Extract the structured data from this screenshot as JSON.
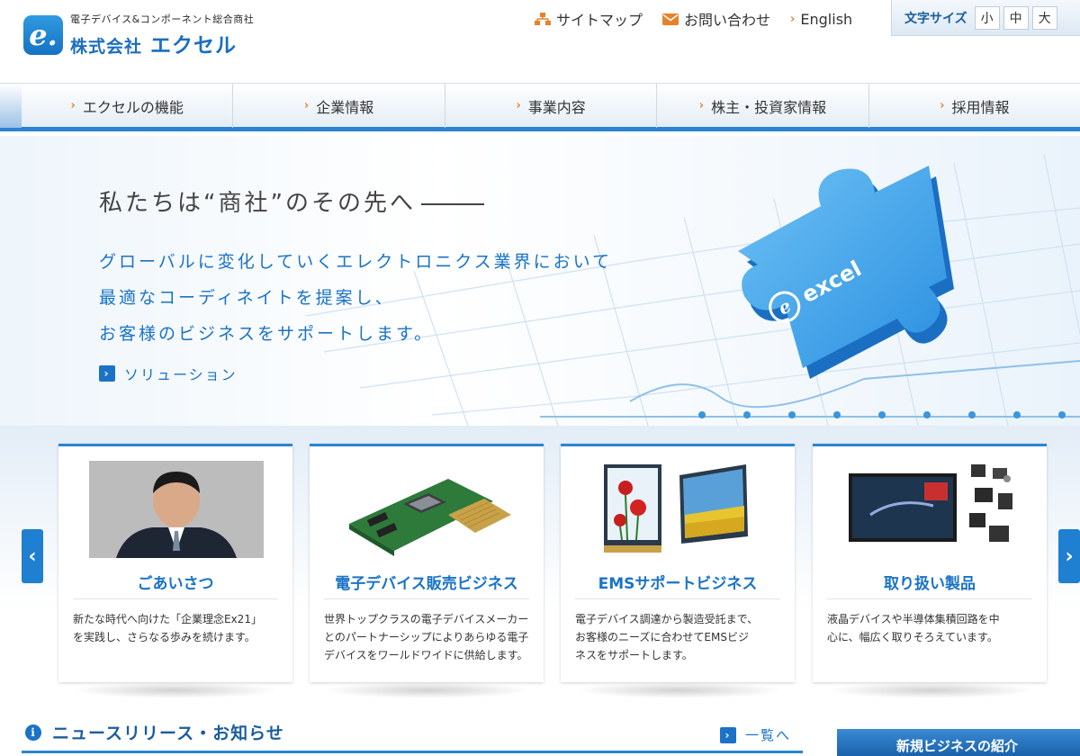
{
  "header": {
    "logo_sub": "電子デバイス&コンポーネント総合商社",
    "logo_kk": "株式会社",
    "logo_name": "エクセル",
    "logo_mark": "e.",
    "links": {
      "sitemap": "サイトマップ",
      "contact": "お問い合わせ",
      "english": "English"
    },
    "font_size": {
      "label": "文字サイズ",
      "small": "小",
      "medium": "中",
      "large": "大"
    }
  },
  "nav": {
    "items": [
      {
        "label": "エクセルの機能"
      },
      {
        "label": "企業情報"
      },
      {
        "label": "事業内容"
      },
      {
        "label": "株主・投資家情報"
      },
      {
        "label": "採用情報"
      }
    ]
  },
  "hero": {
    "title": "私たちは“商社”のその先へ",
    "body_line1": "グローバルに変化していくエレクトロニクス業界において",
    "body_line2": "最適なコーディネイトを提案し、",
    "body_line3": "お客様のビジネスをサポートします。",
    "link": "ソリューション",
    "puzzle_text": "excel"
  },
  "cards": [
    {
      "title": "ごあいさつ",
      "desc_line1": "新たな時代へ向けた「企業理念Ex21」",
      "desc_line2": "を実践し、さらなる歩みを続けます。",
      "desc_line3": ""
    },
    {
      "title": "電子デバイス販売ビジネス",
      "desc_line1": "世界トップクラスの電子デバイスメーカー",
      "desc_line2": "とのパートナーシップによりあらゆる電子",
      "desc_line3": "デバイスをワールドワイドに供給します。"
    },
    {
      "title": "EMSサポートビジネス",
      "desc_line1": "電子デバイス調達から製造受託まで、",
      "desc_line2": "お客様のニーズに合わせてEMSビジ",
      "desc_line3": "ネスをサポートします。"
    },
    {
      "title": "取り扱い製品",
      "desc_line1": "液晶デバイスや半導体集積回路を中",
      "desc_line2": "心に、幅広く取りそろえています。",
      "desc_line3": ""
    }
  ],
  "news": {
    "title": "ニュースリリース・お知らせ",
    "more": "一覧へ",
    "new_business": "新規ビジネスの紹介"
  },
  "colors": {
    "brand_blue": "#1a73c7",
    "accent_orange": "#e8812a",
    "nav_border": "#2a84d2"
  }
}
